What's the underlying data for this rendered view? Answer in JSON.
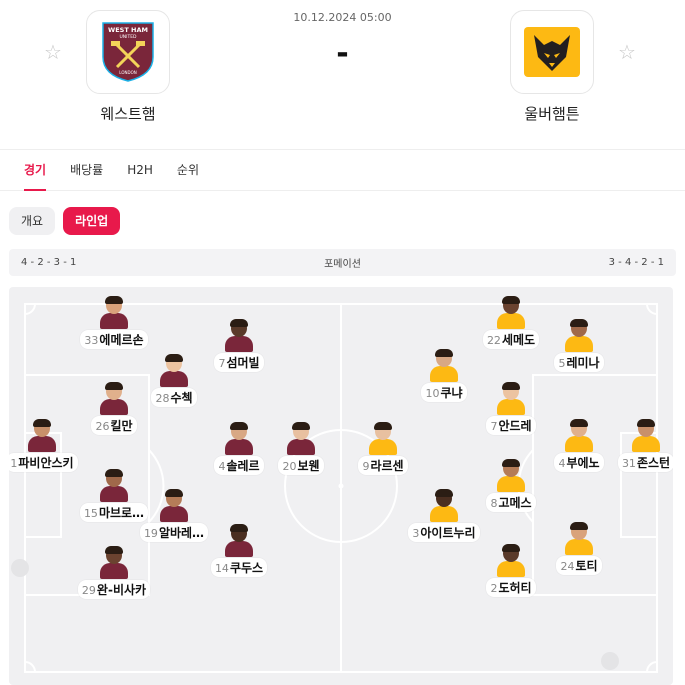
{
  "match": {
    "date": "10.12.2024 05:00",
    "score": "-",
    "home": {
      "name": "웨스트햄",
      "logo_text": "WEST HAM",
      "logo_text2": "UNITED",
      "logo_text3": "LONDON",
      "logo_icon": "west-ham-crest"
    },
    "away": {
      "name": "울버햄튼",
      "logo_icon": "wolves-crest"
    }
  },
  "tabs": [
    "경기",
    "배당률",
    "H2H",
    "순위"
  ],
  "subtabs": [
    "개요",
    "라인업"
  ],
  "formation": {
    "home": "4 - 2 - 3 - 1",
    "label": "포메이션",
    "away": "3 - 4 - 2 - 1"
  },
  "colors": {
    "accent": "#e8194b",
    "home_shirt": "#7a263a",
    "away_shirt": "#fdb913",
    "pitch_line": "#ffffff"
  },
  "home_players": [
    {
      "num": "1",
      "name": "파비안스키"
    },
    {
      "num": "26",
      "name": "킬만"
    },
    {
      "num": "15",
      "name": "마브로…"
    },
    {
      "num": "33",
      "name": "에메르손"
    },
    {
      "num": "29",
      "name": "완-비사카"
    },
    {
      "num": "28",
      "name": "수첵"
    },
    {
      "num": "19",
      "name": "알바레…"
    },
    {
      "num": "7",
      "name": "섬머빌"
    },
    {
      "num": "4",
      "name": "솔레르"
    },
    {
      "num": "14",
      "name": "쿠두스"
    },
    {
      "num": "20",
      "name": "보웬"
    }
  ],
  "away_players": [
    {
      "num": "31",
      "name": "존스턴"
    },
    {
      "num": "4",
      "name": "부에노"
    },
    {
      "num": "5",
      "name": "레미나"
    },
    {
      "num": "24",
      "name": "토티"
    },
    {
      "num": "22",
      "name": "세메도"
    },
    {
      "num": "7",
      "name": "안드레"
    },
    {
      "num": "8",
      "name": "고메스"
    },
    {
      "num": "2",
      "name": "도허티"
    },
    {
      "num": "10",
      "name": "쿠냐"
    },
    {
      "num": "3",
      "name": "아이트누리"
    },
    {
      "num": "9",
      "name": "라르센"
    }
  ]
}
